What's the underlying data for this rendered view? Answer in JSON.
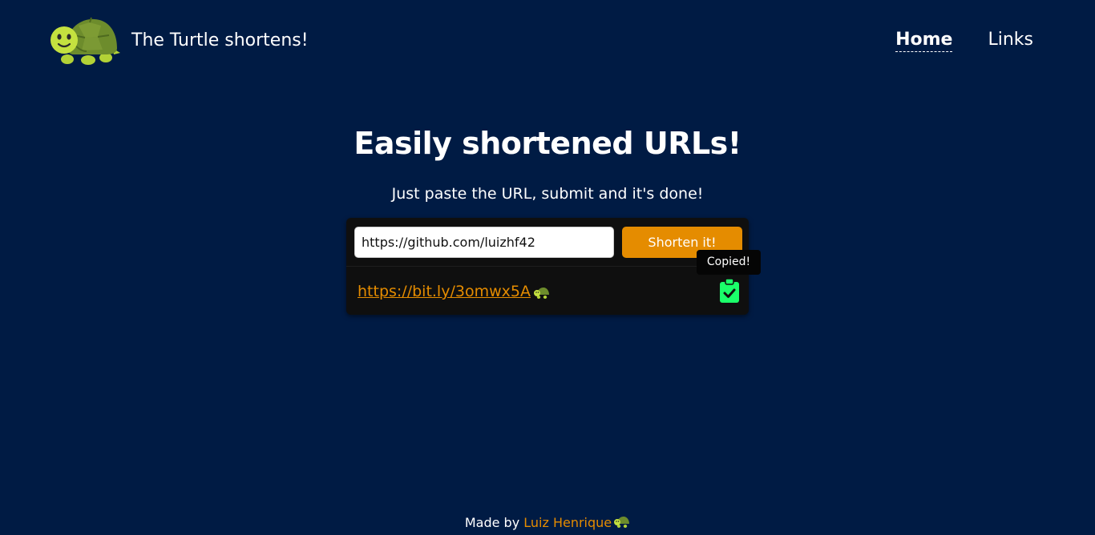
{
  "header": {
    "brand": "The Turtle shortens!",
    "logo_icon": "turtle-icon",
    "nav": [
      {
        "label": "Home",
        "active": true
      },
      {
        "label": "Links",
        "active": false
      }
    ]
  },
  "hero": {
    "title": "Easily shortened URLs!",
    "subtitle": "Just paste the URL, submit and it's done!"
  },
  "form": {
    "url_value": "https://github.com/luizhf42",
    "submit_label": "Shorten it!"
  },
  "result": {
    "short_url": "https://bit.ly/3omwx5A",
    "turtle_icon": "turtle-icon",
    "copy_icon": "clipboard-check-icon",
    "tooltip": "Copied!"
  },
  "footer": {
    "prefix": "Made by ",
    "author": "Luiz Henrique",
    "turtle_icon": "turtle-icon"
  },
  "colors": {
    "background": "#001b44",
    "accent": "#e58c00",
    "card": "#0f0f0f",
    "copy_icon": "#1bff6a"
  }
}
